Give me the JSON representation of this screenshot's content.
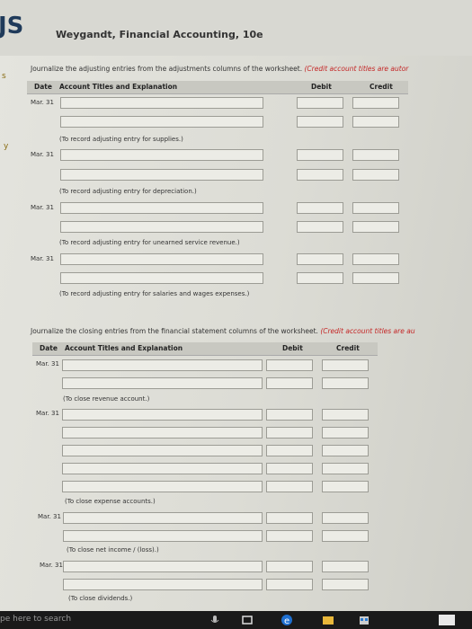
{
  "header": {
    "logo": "JS",
    "book_title": "Weygandt, Financial Accounting, 10e"
  },
  "side_marks": [
    "s",
    "y"
  ],
  "adjusting": {
    "instruction": "Journalize the adjusting entries from the adjustments columns of the worksheet.",
    "instruction_red": "(Credit account titles are autor",
    "columns": {
      "date": "Date",
      "account": "Account Titles and Explanation",
      "debit": "Debit",
      "credit": "Credit"
    },
    "entries": [
      {
        "date": "Mar. 31",
        "note": "(To record adjusting entry for supplies.)"
      },
      {
        "date": "Mar. 31",
        "note": "(To record adjusting entry for depreciation.)"
      },
      {
        "date": "Mar. 31",
        "note": "(To record adjusting entry for unearned service revenue.)"
      },
      {
        "date": "Mar. 31",
        "note": "(To record adjusting entry for salaries and wages expenses.)"
      }
    ]
  },
  "closing": {
    "instruction": "Journalize the closing entries from the financial statement columns of the worksheet.",
    "instruction_red": "(Credit account titles are au",
    "columns": {
      "date": "Date",
      "account": "Account Titles and Explanation",
      "debit": "Debit",
      "credit": "Credit"
    },
    "entries": [
      {
        "date": "Mar. 31",
        "note": "(To close revenue account.)"
      },
      {
        "date": "Mar. 31",
        "note": "(To close expense accounts.)"
      },
      {
        "date": "Mar. 31",
        "note": "(To close net income / (loss).)"
      },
      {
        "date": "Mar. 31",
        "note": "(To close dividends.)"
      }
    ]
  },
  "taskbar": {
    "search_placeholder": "pe here to search"
  },
  "colors": {
    "red_text": "#c42626",
    "header_bg": "#c8c8c1",
    "taskbar": "#1a1a1a",
    "edge_blue": "#1e6fd0"
  }
}
